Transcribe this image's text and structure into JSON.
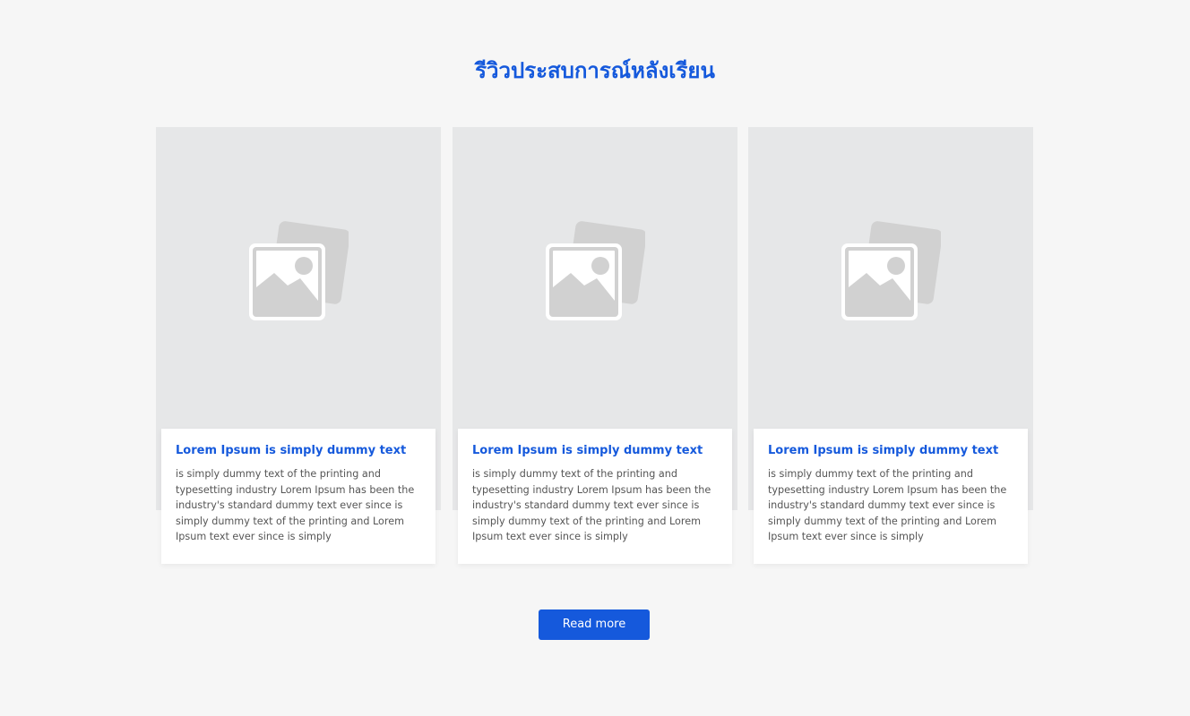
{
  "section": {
    "title": "รีวิวประสบการณ์หลังเรียน"
  },
  "cards": [
    {
      "image_icon": "image-placeholder-icon",
      "title": "Lorem Ipsum is simply dummy text",
      "text": "is simply dummy text of the printing and typesetting industry Lorem Ipsum has been the industry's standard dummy text ever since is simply dummy text of the printing and Lorem Ipsum text ever since is simply"
    },
    {
      "image_icon": "image-placeholder-icon",
      "title": "Lorem Ipsum is simply dummy text",
      "text": "is simply dummy text of the printing and typesetting industry Lorem Ipsum has been the industry's standard dummy text ever since is simply dummy text of the printing and Lorem Ipsum text ever since is simply"
    },
    {
      "image_icon": "image-placeholder-icon",
      "title": "Lorem Ipsum is simply dummy text",
      "text": "is simply dummy text of the printing and typesetting industry Lorem Ipsum has been the industry's standard dummy text ever since is simply dummy text of the printing and Lorem Ipsum text ever since is simply"
    }
  ],
  "actions": {
    "read_more_label": "Read more"
  },
  "colors": {
    "accent": "#1559dc",
    "background": "#f6f6f6",
    "image_placeholder": "#e6e7e8",
    "icon": "#d1d1d1",
    "body_text": "#555555"
  }
}
